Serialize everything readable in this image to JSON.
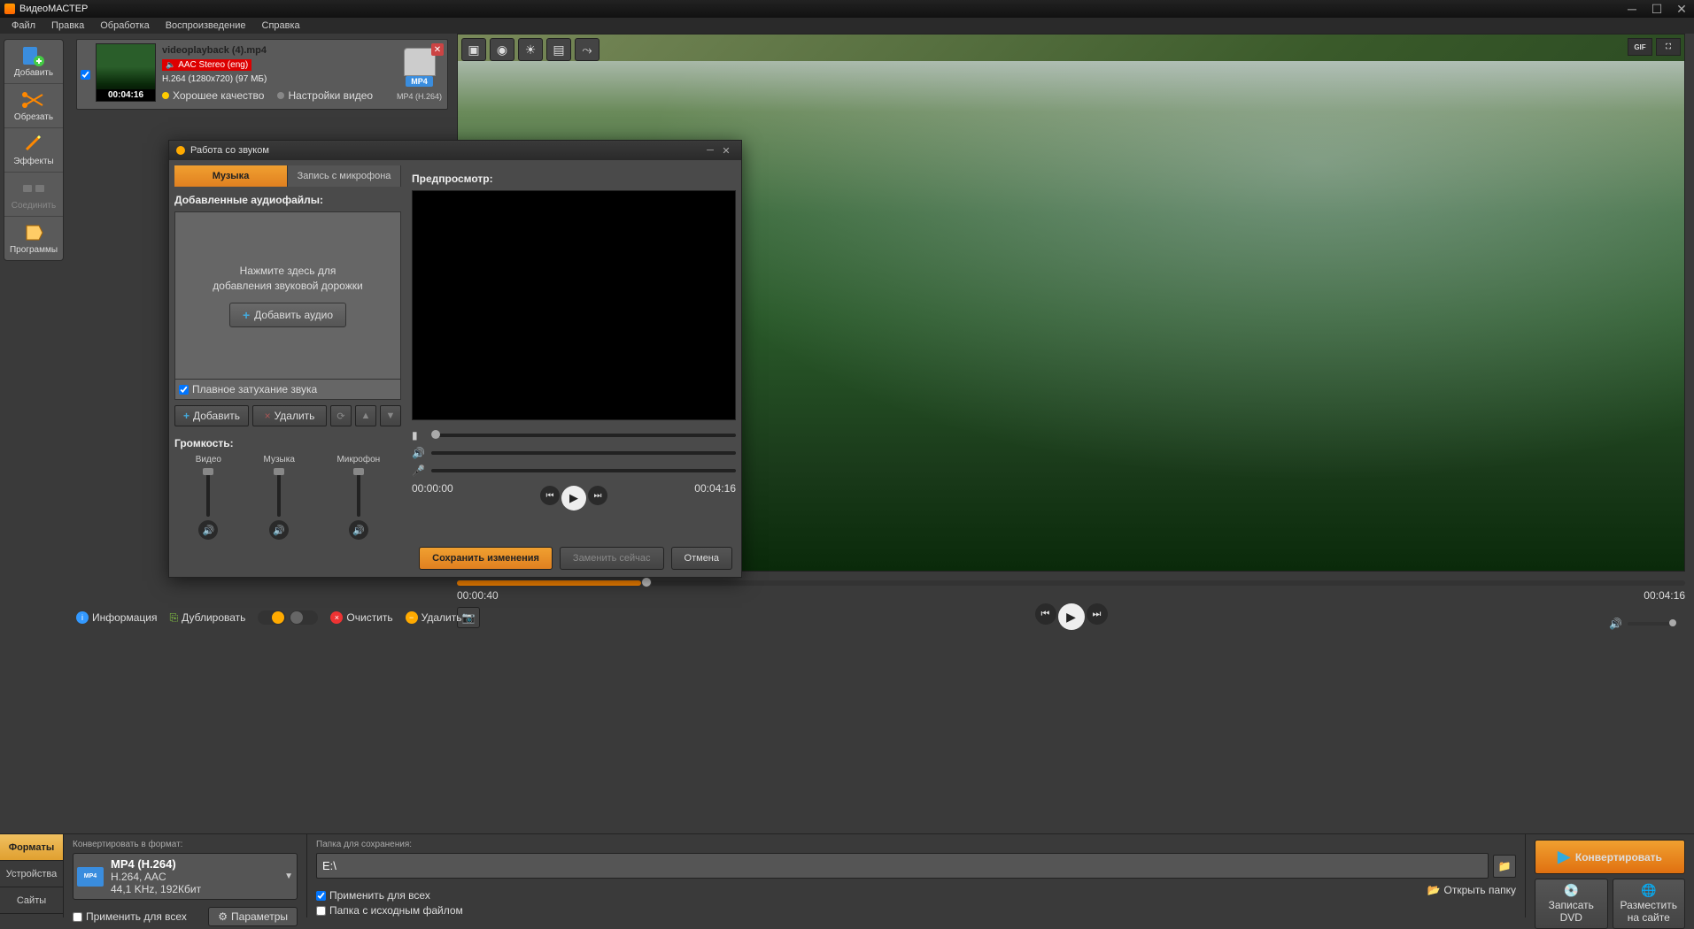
{
  "app": {
    "title": "ВидеоМАСТЕР"
  },
  "menu": [
    "Файл",
    "Правка",
    "Обработка",
    "Воспроизведение",
    "Справка"
  ],
  "sidebar": [
    {
      "label": "Добавить"
    },
    {
      "label": "Обрезать"
    },
    {
      "label": "Эффекты"
    },
    {
      "label": "Соединить"
    },
    {
      "label": "Программы"
    }
  ],
  "file": {
    "name": "videoplayback (4).mp4",
    "audio_highlight": "AAC Stereo (eng)",
    "video_meta": "H.264 (1280x720) (97 МБ)",
    "duration": "00:04:16",
    "quality": "Хорошее качество",
    "settings": "Настройки видео",
    "format_badge": "MP4",
    "format_text": "MP4 (H.264)"
  },
  "preview_toolbar_right": {
    "gif": "GIF"
  },
  "dialog": {
    "title": "Работа со звуком",
    "tabs": {
      "music": "Музыка",
      "mic": "Запись с микрофона"
    },
    "added_files": "Добавленные аудиофайлы:",
    "hint_line1": "Нажмите здесь для",
    "hint_line2": "добавления звуковой дорожки",
    "add_audio": "Добавить аудио",
    "fade": "Плавное затухание звука",
    "add": "Добавить",
    "del": "Удалить",
    "volume": "Громкость:",
    "vol_video": "Видео",
    "vol_music": "Музыка",
    "vol_mic": "Микрофон",
    "preview_label": "Предпросмотр:",
    "time_start": "00:00:00",
    "time_end": "00:04:16",
    "save": "Сохранить изменения",
    "replace": "Заменить сейчас",
    "cancel": "Отмена"
  },
  "timeline": {
    "pos": "00:00:40",
    "total": "00:04:16"
  },
  "action_row": {
    "info": "Информация",
    "dup": "Дублировать",
    "clear": "Очистить",
    "del": "Удалить"
  },
  "bottom": {
    "tabs": {
      "formats": "Форматы",
      "devices": "Устройства",
      "sites": "Сайты"
    },
    "format_label": "Конвертировать в формат:",
    "format_name": "MP4 (H.264)",
    "format_detail": "H.264, AAC\n44,1 KHz, 192Кбит",
    "format_detail_l1": "H.264, AAC",
    "format_detail_l2": "44,1 KHz, 192Кбит",
    "apply_all": "Применить для всех",
    "params": "Параметры",
    "folder_label": "Папка для сохранения:",
    "folder_path": "E:\\",
    "chk_apply_all": "Применить для всех",
    "chk_src_folder": "Папка с исходным файлом",
    "open_folder": "Открыть папку",
    "convert": "Конвертировать",
    "write_dvd_l1": "Записать",
    "write_dvd_l2": "DVD",
    "publish_l1": "Разместить",
    "publish_l2": "на сайте"
  }
}
